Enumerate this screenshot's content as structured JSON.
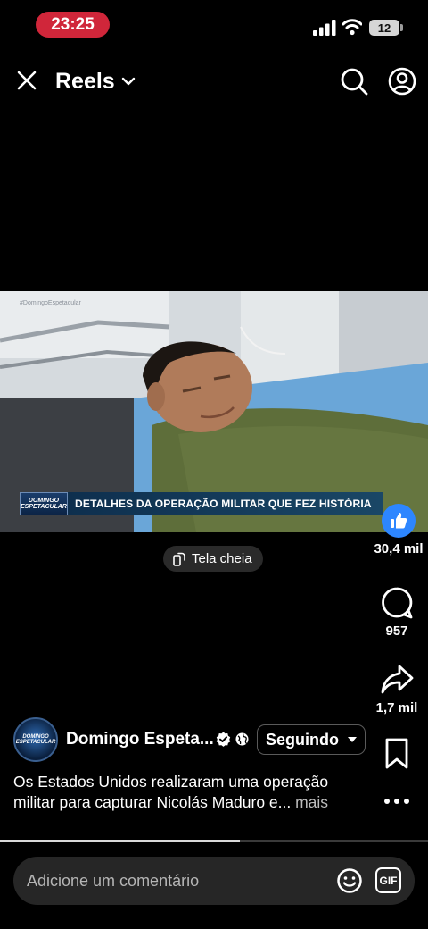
{
  "status_bar": {
    "time": "23:25",
    "battery": "12"
  },
  "header": {
    "title": "Reels"
  },
  "video": {
    "watermark": "#DomingoEspetacular",
    "lower_third_logo_line1": "DOMINGO",
    "lower_third_logo_line2": "ESPETACULAR",
    "lower_third_text": "DETALHES DA OPERAÇÃO MILITAR QUE FEZ HISTÓRIA",
    "progress": 0.56
  },
  "fullscreen_label": "Tela cheia",
  "actions": {
    "likes": "30,4 mil",
    "comments": "957",
    "shares": "1,7 mil"
  },
  "page": {
    "name": "Domingo Espeta...",
    "avatar_text": "DOMINGO ESPETACULAR",
    "follow_label": "Seguindo"
  },
  "caption": {
    "text": "Os Estados Unidos realizaram uma operação militar para capturar Nicolás Maduro e...",
    "more": "mais"
  },
  "comment_bar": {
    "placeholder": "Adicione um comentário",
    "gif_label": "GIF"
  }
}
